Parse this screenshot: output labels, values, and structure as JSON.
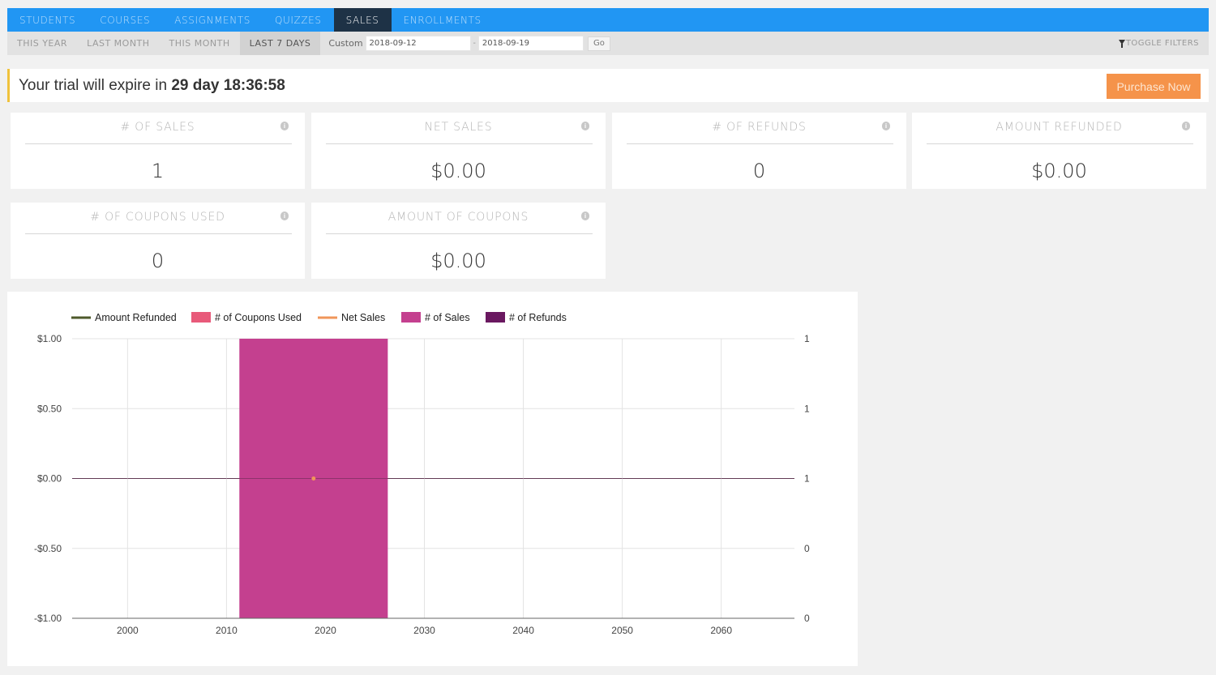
{
  "nav": {
    "tabs": [
      {
        "label": "STUDENTS",
        "active": false
      },
      {
        "label": "COURSES",
        "active": false
      },
      {
        "label": "ASSIGNMENTS",
        "active": false
      },
      {
        "label": "QUIZZES",
        "active": false
      },
      {
        "label": "SALES",
        "active": true
      },
      {
        "label": "ENROLLMENTS",
        "active": false
      }
    ]
  },
  "filters": {
    "ranges": [
      {
        "label": "THIS YEAR",
        "active": false
      },
      {
        "label": "LAST MONTH",
        "active": false
      },
      {
        "label": "THIS MONTH",
        "active": false
      },
      {
        "label": "LAST 7 DAYS",
        "active": true
      }
    ],
    "custom_label": "Custom",
    "date_from": "2018-09-12",
    "separator": "-",
    "date_to": "2018-09-19",
    "go_label": "Go",
    "toggle_label": "TOGGLE FILTERS",
    "toggle_icon": "filter-icon"
  },
  "trial": {
    "prefix": "Your trial will expire in ",
    "remaining": "29 day 18:36:58",
    "purchase_label": "Purchase Now",
    "accent_color": "#f0c23c",
    "button_color": "#f5934a"
  },
  "stats": [
    {
      "title": "# OF SALES",
      "value": "1",
      "icon": "info-icon"
    },
    {
      "title": "NET SALES",
      "value": "$0.00",
      "icon": "info-icon"
    },
    {
      "title": "# OF REFUNDS",
      "value": "0",
      "icon": "info-icon"
    },
    {
      "title": "AMOUNT REFUNDED",
      "value": "$0.00",
      "icon": "info-icon"
    },
    {
      "title": "# OF COUPONS USED",
      "value": "0",
      "icon": "info-icon"
    },
    {
      "title": "AMOUNT OF COUPONS",
      "value": "$0.00",
      "icon": "info-icon"
    }
  ],
  "chart_data": {
    "type": "bar",
    "title": "",
    "legend_position": "top-left",
    "legend": [
      {
        "name": "Amount Refunded",
        "kind": "line",
        "color": "#4e5a2b"
      },
      {
        "name": "# of Coupons Used",
        "kind": "bar",
        "color": "#e85a7a"
      },
      {
        "name": "Net Sales",
        "kind": "line",
        "color": "#f0965a"
      },
      {
        "name": "# of Sales",
        "kind": "bar",
        "color": "#c4408f"
      },
      {
        "name": "# of Refunds",
        "kind": "bar",
        "color": "#6a1860"
      }
    ],
    "x_axis": {
      "ticks": [
        2000,
        2010,
        2020,
        2030,
        2040,
        2050,
        2060
      ],
      "range": [
        1994.4,
        2067.4
      ],
      "grid": true
    },
    "y_left": {
      "ticks": [
        "$1.00",
        "$0.50",
        "$0.00",
        "-$0.50",
        "-$1.00"
      ],
      "values": [
        1,
        0.5,
        0,
        -0.5,
        -1
      ],
      "range": [
        -1,
        1
      ]
    },
    "y_right": {
      "ticks": [
        "1",
        "1",
        "1",
        "0",
        "0"
      ],
      "range": [
        0,
        1
      ]
    },
    "series": [
      {
        "name": "# of Sales",
        "type": "bar",
        "axis": "right",
        "x": [
          2018.8
        ],
        "values": [
          1
        ],
        "bar_span": [
          2011.3,
          2026.3
        ]
      },
      {
        "name": "Net Sales",
        "type": "line",
        "axis": "left",
        "x": [
          2018.8
        ],
        "values": [
          0
        ]
      },
      {
        "name": "Amount Refunded",
        "type": "line",
        "axis": "left",
        "x": [
          2018.8
        ],
        "values": [
          0
        ]
      },
      {
        "name": "# of Coupons Used",
        "type": "bar",
        "axis": "right",
        "x": [
          2018.8
        ],
        "values": [
          0
        ]
      },
      {
        "name": "# of Refunds",
        "type": "bar",
        "axis": "right",
        "x": [
          2018.8
        ],
        "values": [
          0
        ]
      }
    ]
  }
}
